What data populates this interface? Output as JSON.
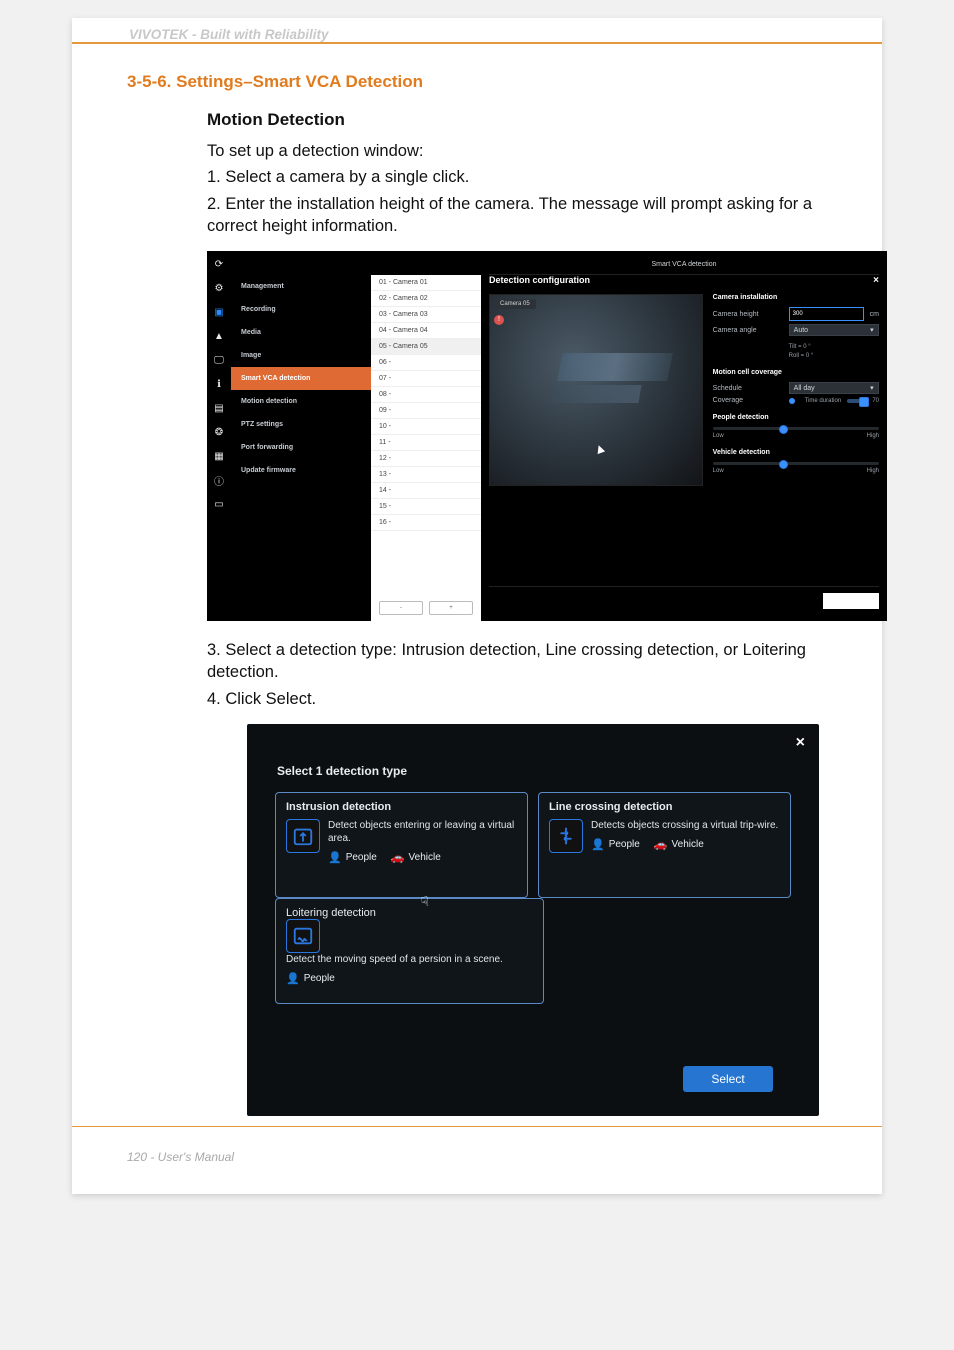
{
  "brand_line": "VIVOTEK - Built with Reliability",
  "section_heading": "3-5-6. Settings–Smart VCA Detection",
  "subsection_heading": "Motion Detection",
  "intro_text": "To set up a detection window:",
  "steps_a": [
    "1. Select a camera by a single click.",
    "2. Enter the installation height of the camera. The message will prompt asking for a correct height information."
  ],
  "steps_b": [
    "3. Select a detection type: Intrusion detection, Line crossing detection, or Loitering detection.",
    "4. Click Select."
  ],
  "footer": "120 - User's Manual",
  "shot1": {
    "tab": "Smart VCA detection",
    "dialog_title": "Detection configuration",
    "close": "×",
    "preview_label": "Camera 05",
    "warn_glyph": "!",
    "nav": [
      {
        "label": "Management"
      },
      {
        "label": "Recording"
      },
      {
        "label": "Media"
      },
      {
        "label": "Image"
      },
      {
        "label": "Smart VCA detection",
        "active": true
      },
      {
        "label": "Motion detection"
      },
      {
        "label": "PTZ settings"
      },
      {
        "label": "Port forwarding"
      },
      {
        "label": "Update firmware"
      }
    ],
    "cam_list": [
      "01 - Camera 01",
      "02 - Camera 02",
      "03 - Camera 03",
      "04 - Camera 04",
      "05 - Camera 05",
      "06 -",
      "07 -",
      "08 -",
      "09 -",
      "10 -",
      "11 -",
      "12 -",
      "13 -",
      "14 -",
      "15 -",
      "16 -"
    ],
    "cam_selected_index": 4,
    "cam_footer": {
      "left": "-",
      "right": "+"
    },
    "install": {
      "header": "Camera installation",
      "height_label": "Camera height",
      "height_value": "300",
      "height_unit": "cm",
      "angle_label": "Camera angle",
      "angle_value": "Auto",
      "tilt_line": "Tilt = 0  °",
      "roll_line": "Roll = 0  °"
    },
    "coverage": {
      "header": "Motion cell coverage",
      "schedule_label": "Schedule",
      "schedule_value": "All day",
      "coverage_label": "Coverage",
      "mode_label": "Time duration",
      "coverage_value": "70"
    },
    "people": {
      "header": "People detection",
      "low": "Low",
      "high": "High"
    },
    "vehicle": {
      "header": "Vehicle detection",
      "low": "Low",
      "high": "High"
    }
  },
  "shot2": {
    "close": "×",
    "title": "Select 1 detection type",
    "cards": {
      "intrusion": {
        "title": "Instrusion detection",
        "desc": "Detect objects entering or leaving a virtual area.",
        "tag_people": "People",
        "tag_vehicle": "Vehicle"
      },
      "line": {
        "title": "Line crossing detection",
        "desc": "Detects objects crossing a virtual trip-wire.",
        "tag_people": "People",
        "tag_vehicle": "Vehicle"
      },
      "loiter": {
        "title": "Loitering detection",
        "desc": "Detect the moving speed of a persion in a scene.",
        "tag_people": "People"
      }
    },
    "select_btn": "Select"
  }
}
